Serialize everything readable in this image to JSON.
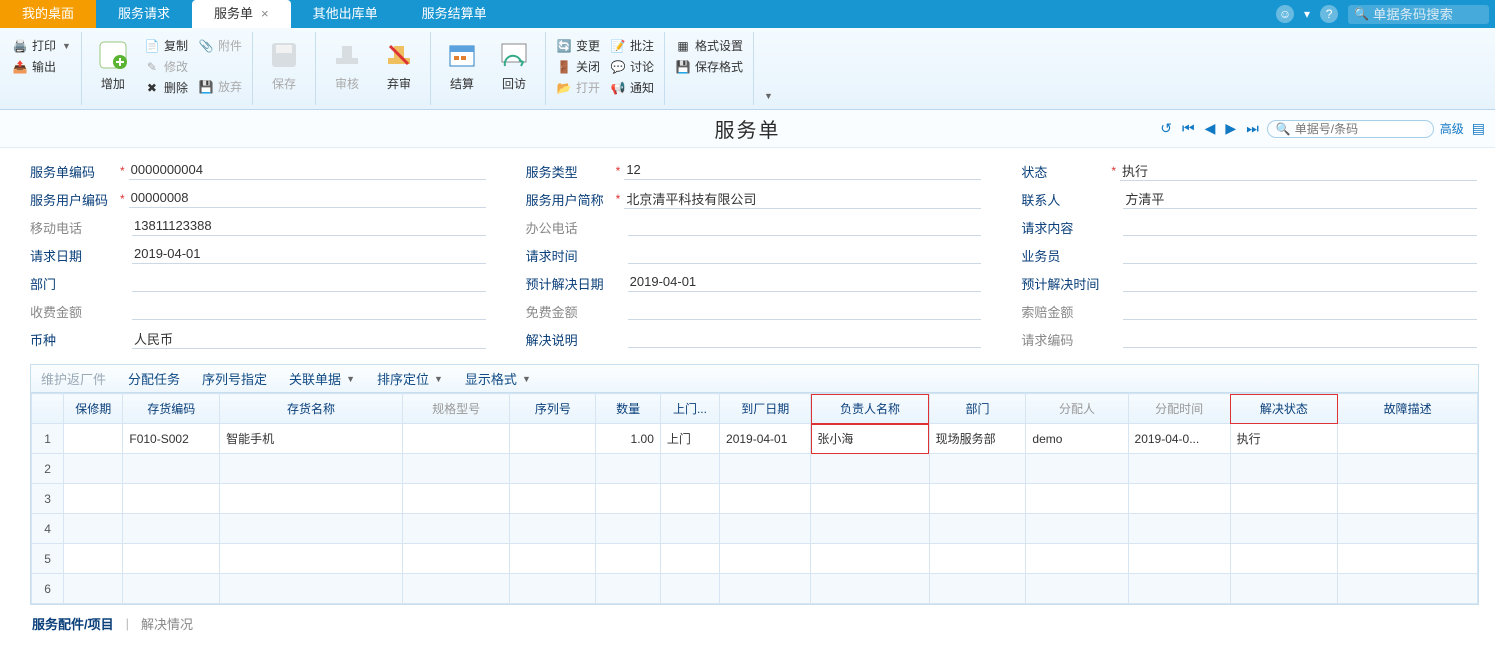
{
  "tabs": {
    "t0": "我的桌面",
    "t1": "服务请求",
    "t2": "服务单",
    "t3": "其他出库单",
    "t4": "服务结算单"
  },
  "top_search_placeholder": "单据条码搜索",
  "toolbar": {
    "print": "打印",
    "export": "输出",
    "add": "增加",
    "copy": "复制",
    "modify": "修改",
    "delete": "删除",
    "attach": "附件",
    "abandon": "放弃",
    "save": "保存",
    "review": "审核",
    "reject": "弃审",
    "settle": "结算",
    "revisit": "回访",
    "change": "变更",
    "close": "关闭",
    "open": "打开",
    "approve": "批注",
    "discuss": "讨论",
    "notify": "通知",
    "fmtset": "格式设置",
    "fmtsave": "保存格式"
  },
  "page_title": "服务单",
  "nav_search_placeholder": "单据号/条码",
  "adv": "高级",
  "form": {
    "l_code": "服务单编码",
    "v_code": "0000000004",
    "l_type": "服务类型",
    "v_type": "12",
    "l_status": "状态",
    "v_status": "执行",
    "l_ucode": "服务用户编码",
    "v_ucode": "00000008",
    "l_uname": "服务用户简称",
    "v_uname": "北京清平科技有限公司",
    "l_contact": "联系人",
    "v_contact": "方清平",
    "l_mobile": "移动电话",
    "v_mobile": "13811123388",
    "l_ophone": "办公电话",
    "v_ophone": "",
    "l_reqcontent": "请求内容",
    "v_reqcontent": "",
    "l_reqdate": "请求日期",
    "v_reqdate": "2019-04-01",
    "l_reqtime": "请求时间",
    "v_reqtime": "",
    "l_sales": "业务员",
    "v_sales": "",
    "l_dept": "部门",
    "v_dept": "",
    "l_estdate": "预计解决日期",
    "v_estdate": "2019-04-01",
    "l_esttime": "预计解决时间",
    "v_esttime": "",
    "l_fee": "收费金额",
    "v_fee": "",
    "l_free": "免费金额",
    "v_free": "",
    "l_claim": "索赔金额",
    "v_claim": "",
    "l_currency": "币种",
    "v_currency": "人民币",
    "l_solvedesc": "解决说明",
    "v_solvedesc": "",
    "l_reqno": "请求编码",
    "v_reqno": ""
  },
  "actions": {
    "a0": "维护返厂件",
    "a1": "分配任务",
    "a2": "序列号指定",
    "a3": "关联单据",
    "a4": "排序定位",
    "a5": "显示格式"
  },
  "headers": {
    "h0": "保修期",
    "h1": "存货编码",
    "h2": "存货名称",
    "h3": "规格型号",
    "h4": "序列号",
    "h5": "数量",
    "h6": "上门...",
    "h7": "到厂日期",
    "h8": "负责人名称",
    "h9": "部门",
    "h10": "分配人",
    "h11": "分配时间",
    "h12": "解决状态",
    "h13": "故障描述"
  },
  "rows": [
    {
      "warranty": "",
      "invcode": "F010-S002",
      "invname": "智能手机",
      "spec": "",
      "serial": "",
      "qty": "1.00",
      "visit": "上门",
      "arrdate": "2019-04-01",
      "owner": "张小海",
      "dept": "现场服务部",
      "assignee": "demo",
      "assigntime": "2019-04-0...",
      "status": "执行",
      "fault": ""
    }
  ],
  "bottom": {
    "b0": "服务配件/项目",
    "b1": "解决情况"
  }
}
